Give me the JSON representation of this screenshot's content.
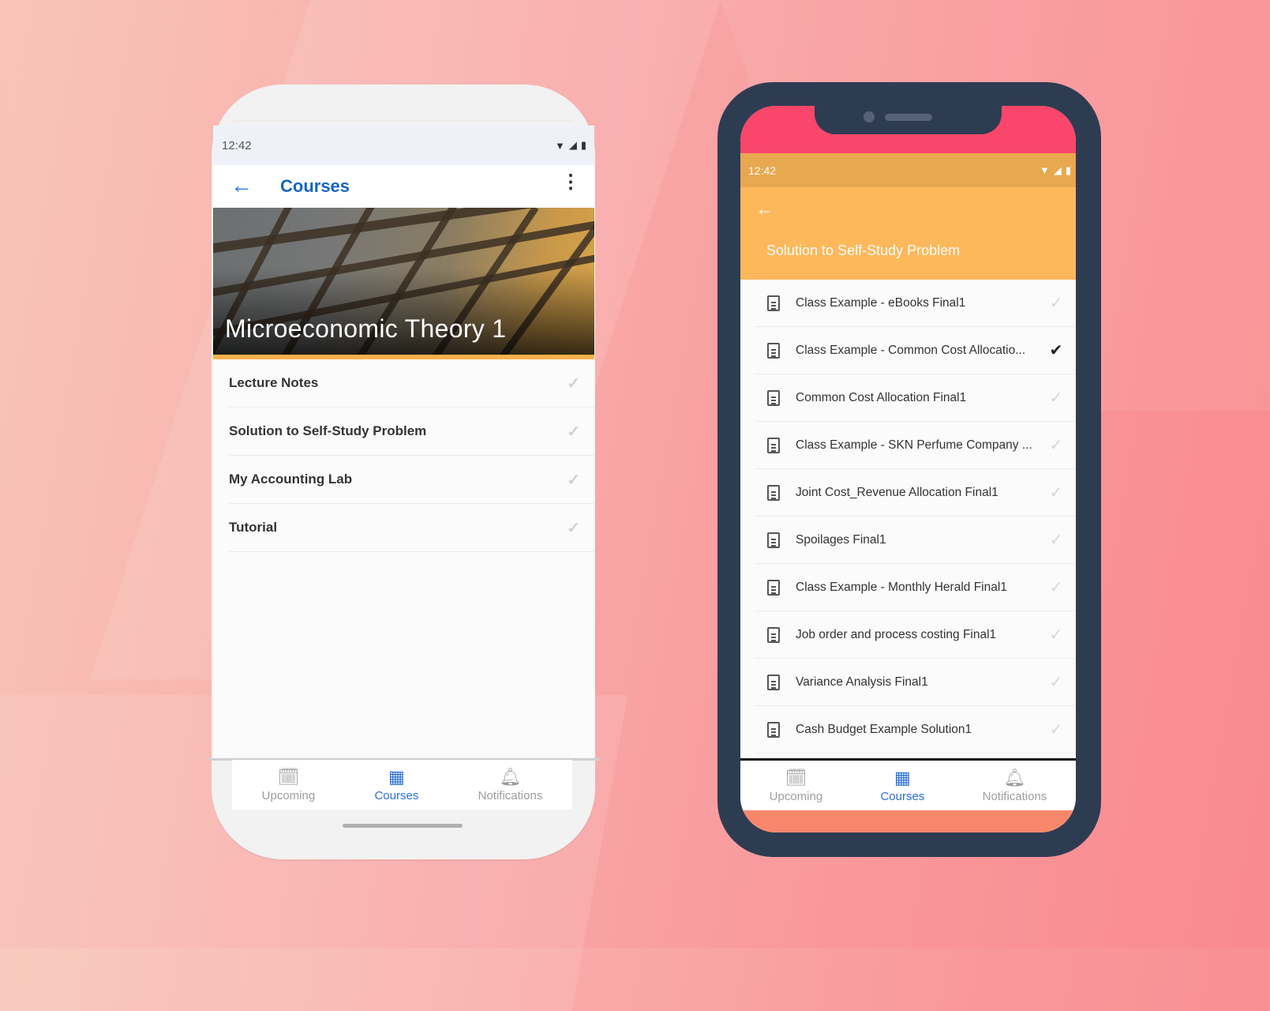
{
  "left_phone": {
    "status_time": "12:42",
    "appbar": {
      "back_icon": "back-arrow-icon",
      "title": "Courses",
      "menu_icon": "more-vert-icon"
    },
    "hero_title": "Microeconomic Theory 1",
    "sections": [
      {
        "label": "Lecture Notes",
        "checked": false
      },
      {
        "label": "Solution to Self-Study Problem",
        "checked": false
      },
      {
        "label": "My Accounting Lab",
        "checked": false
      },
      {
        "label": "Tutorial",
        "checked": false
      }
    ],
    "bottom_nav": [
      {
        "label": "Upcoming",
        "icon": "calendar-icon",
        "active": false
      },
      {
        "label": "Courses",
        "icon": "grid-icon",
        "active": true
      },
      {
        "label": "Notifications",
        "icon": "bell-icon",
        "active": false
      }
    ]
  },
  "right_phone": {
    "status_time": "12:42",
    "appbar": {
      "back_icon": "back-arrow-icon",
      "title": "Solution to Self-Study Problem"
    },
    "files": [
      {
        "label": "Class Example - eBooks Final1",
        "checked": false
      },
      {
        "label": "Class Example - Common Cost Allocatio...",
        "checked": true
      },
      {
        "label": "Common Cost Allocation Final1",
        "checked": false
      },
      {
        "label": "Class Example - SKN Perfume Company ...",
        "checked": false
      },
      {
        "label": "Joint Cost_Revenue Allocation Final1",
        "checked": false
      },
      {
        "label": "Spoilages Final1",
        "checked": false
      },
      {
        "label": "Class Example - Monthly Herald Final1",
        "checked": false
      },
      {
        "label": "Job order and process costing Final1",
        "checked": false
      },
      {
        "label": "Variance Analysis Final1",
        "checked": false
      },
      {
        "label": "Cash Budget Example Solution1",
        "checked": false
      }
    ],
    "bottom_nav": [
      {
        "label": "Upcoming",
        "icon": "calendar-icon",
        "active": false
      },
      {
        "label": "Courses",
        "icon": "grid-icon",
        "active": true
      },
      {
        "label": "Notifications",
        "icon": "bell-icon",
        "active": false
      }
    ]
  },
  "colors": {
    "accent_blue": "#1565c0",
    "orange_header": "#fdb85b",
    "orange_statusbar": "#e8a84f",
    "pink_frame_top": "#f9466a",
    "phone_frame_dark": "#2e3c52",
    "background_coral": "#f98a8e"
  }
}
